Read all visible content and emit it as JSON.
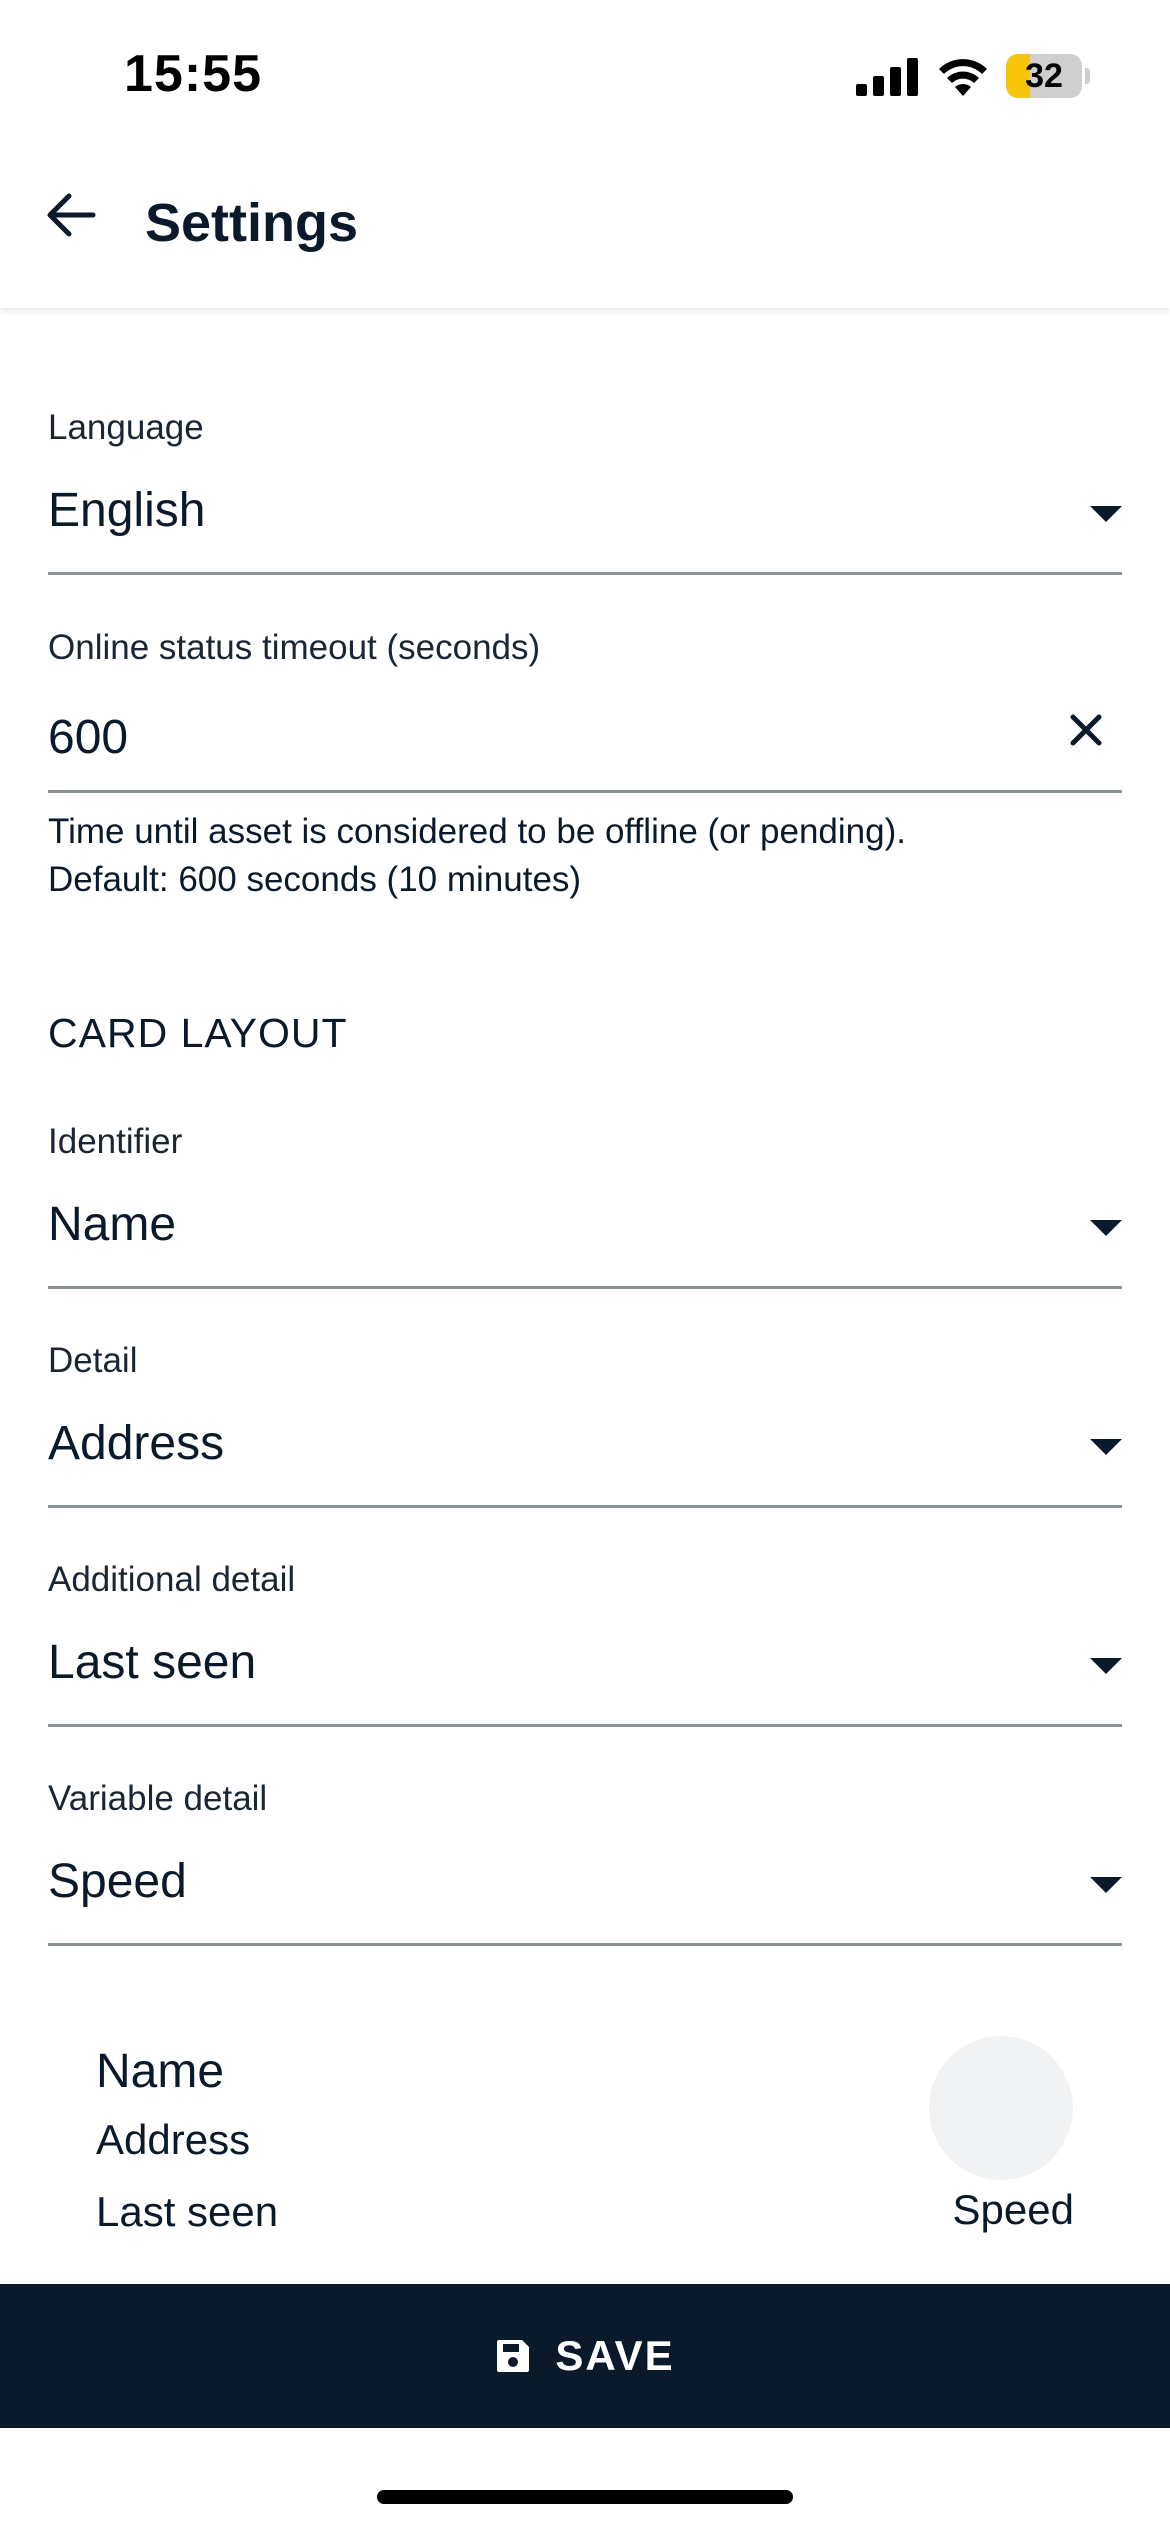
{
  "status_bar": {
    "time": "15:55",
    "battery_level": "32",
    "battery_fraction": 0.32
  },
  "app_bar": {
    "title": "Settings"
  },
  "settings": {
    "language": {
      "label": "Language",
      "value": "English"
    },
    "online_timeout": {
      "label": "Online status timeout (seconds)",
      "value": "600",
      "helper_line1": "Time until asset is considered to be offline (or pending).",
      "helper_line2": "Default: 600 seconds (10 minutes)"
    }
  },
  "card_layout": {
    "heading": "CARD LAYOUT",
    "identifier": {
      "label": "Identifier",
      "value": "Name"
    },
    "detail": {
      "label": "Detail",
      "value": "Address"
    },
    "additional_detail": {
      "label": "Additional detail",
      "value": "Last seen"
    },
    "variable_detail": {
      "label": "Variable detail",
      "value": "Speed"
    }
  },
  "preview": {
    "name": "Name",
    "address": "Address",
    "last_seen": "Last seen",
    "variable": "Speed"
  },
  "actions": {
    "save_label": "SAVE"
  },
  "colors": {
    "primary": "#0b1a2b",
    "underline": "#8a929b",
    "battery_fill": "#f7c40a"
  }
}
